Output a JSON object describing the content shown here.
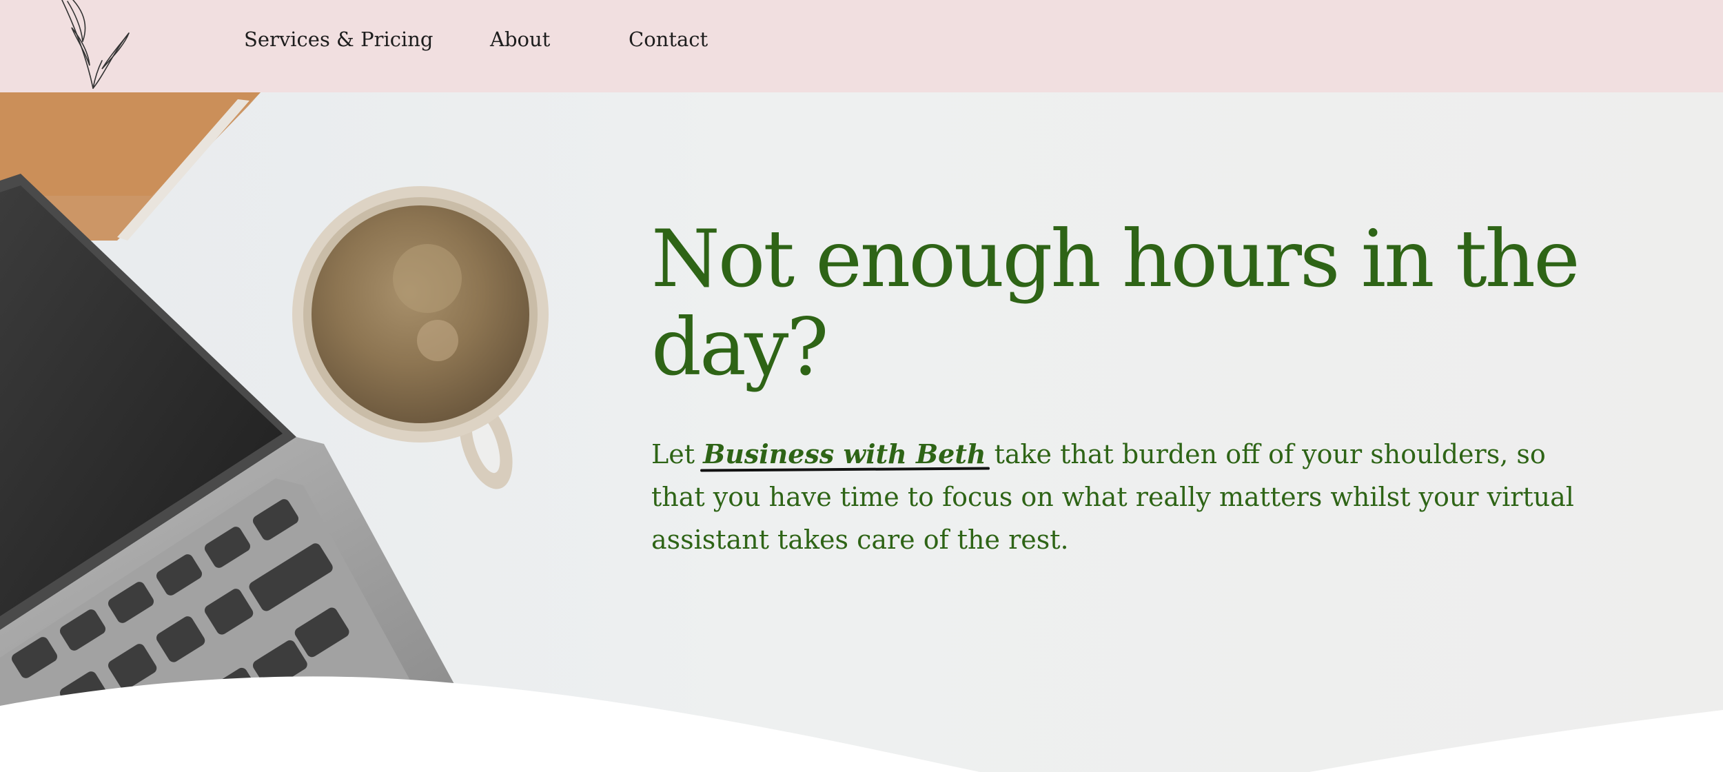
{
  "header": {
    "logo_icon": "leaf-sprig-icon",
    "nav": [
      {
        "label": "Services & Pricing"
      },
      {
        "label": "About"
      },
      {
        "label": "Contact"
      }
    ]
  },
  "hero": {
    "headline": "Not enough hours in the day?",
    "intro_before": "Let ",
    "brand_name": "Business with Beth",
    "intro_after": " take that burden off of your shoulders, so that you have time to focus on what really matters whilst your virtual assistant takes care of the rest."
  },
  "colors": {
    "header_bg": "#f1dfe0",
    "accent_green": "#2e6416",
    "hero_bg": "#eeeeed"
  }
}
